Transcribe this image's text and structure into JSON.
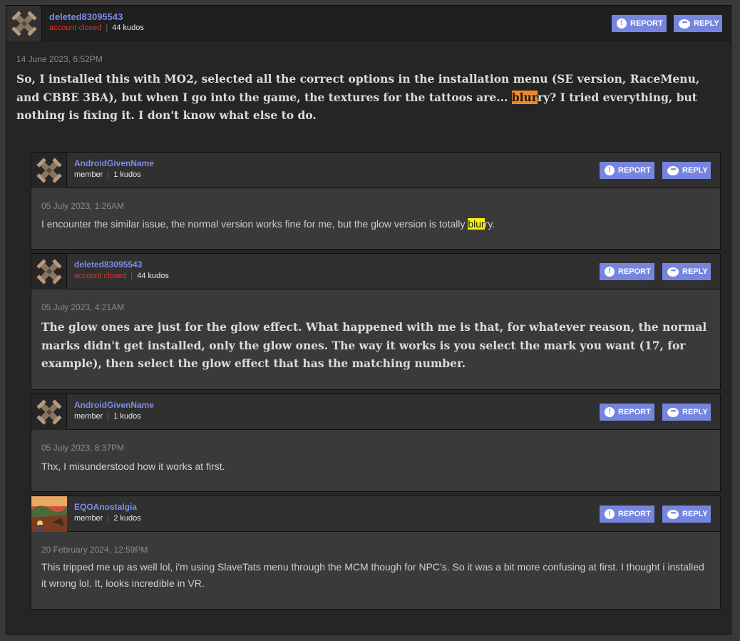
{
  "main_post": {
    "username": "deleted83095543",
    "status": "account closed",
    "kudos": "44 kudos",
    "report_label": "REPORT",
    "reply_label": "REPLY",
    "date": "14 June 2023, 6:52PM",
    "text_before": "So, I installed this with MO2, selected all the correct options in the installation menu (SE version, RaceMenu, and CBBE 3BA), but when I go into the game, the textures for the tattoos are... ",
    "text_highlight": "blur",
    "text_after": "ry? I tried everything, but nothing is fixing it. I don't know what else to do."
  },
  "replies": [
    {
      "username": "AndroidGivenName",
      "role": "member",
      "kudos": "1 kudos",
      "report_label": "REPORT",
      "reply_label": "REPLY",
      "date": "05 July 2023, 1:26AM",
      "text_before": "I encounter the similar issue, the normal version works fine for me, but the glow version is totally ",
      "text_highlight": "blur",
      "text_after": "ry."
    },
    {
      "username": "deleted83095543",
      "status": "account closed",
      "kudos": "44 kudos",
      "report_label": "REPORT",
      "reply_label": "REPLY",
      "date": "05 July 2023, 4:21AM",
      "text": "The glow ones are just for the glow effect. What happened with me is that, for whatever reason, the normal marks didn't get installed, only the glow ones. The way it works is you select the mark you want (17, for example), then select the glow effect that has the matching number."
    },
    {
      "username": "AndroidGivenName",
      "role": "member",
      "kudos": "1 kudos",
      "report_label": "REPORT",
      "reply_label": "REPLY",
      "date": "05 July 2023, 8:37PM",
      "text": "Thx, I misunderstood how it works at first."
    },
    {
      "username": "EQOAnostalgia",
      "role": "member",
      "kudos": "2 kudos",
      "report_label": "REPORT",
      "reply_label": "REPLY",
      "date": "20 February 2024, 12:59PM",
      "text": "This tripped me up as well lol, i'm using SlaveTats menu through the MCM though for NPC's. So it was a bit more confusing at first. I thought i installed it wrong lol. It, looks incredible in VR."
    }
  ],
  "icons": {
    "report": "exclamation-circle-icon",
    "reply": "speech-bubble-icon",
    "default_avatar": "crossed-tools-avatar-icon"
  },
  "colors": {
    "username": "#7c8cea",
    "button": "#7585de",
    "account_closed": "#e3312a",
    "highlight_current": "#f08a28",
    "highlight": "#f4f20a"
  }
}
